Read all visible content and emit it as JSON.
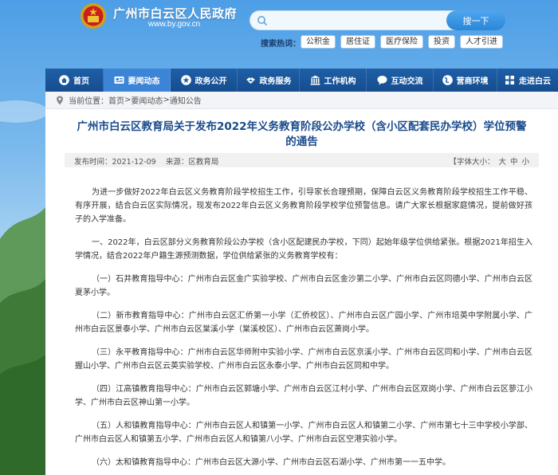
{
  "site": {
    "title": "广州市白云区人民政府",
    "url": "www.by.gov.cn"
  },
  "search": {
    "placeholder": "",
    "button": "搜一下",
    "hot_label": "搜索热词：",
    "hot_tags": [
      "公积金",
      "居住证",
      "医疗保险",
      "投资",
      "人才引进"
    ]
  },
  "nav": [
    {
      "label": "首页",
      "icon": "home-icon"
    },
    {
      "label": "要闻动态",
      "icon": "news-icon",
      "active": true
    },
    {
      "label": "政务公开",
      "icon": "star-icon"
    },
    {
      "label": "政务服务",
      "icon": "hands-icon"
    },
    {
      "label": "工作机构",
      "icon": "building-icon"
    },
    {
      "label": "互动交流",
      "icon": "chat-icon"
    },
    {
      "label": "营商环境",
      "icon": "globe-icon"
    },
    {
      "label": "走进白云",
      "icon": "grid-icon"
    }
  ],
  "breadcrumb": {
    "prefix": "当前位置：",
    "items": [
      "首页",
      "要闻动态",
      "通知公告"
    ],
    "sep": " > "
  },
  "article": {
    "title_line1": "广州市白云区教育局关于发布2022年义务教育阶段公办学校（含小区配套民办学校）学位预警",
    "title_line2": "的通告",
    "publish_label": "发布时间：",
    "publish_date": "2021-12-09",
    "source_label": "来源：",
    "source": "区教育局",
    "font_size_label": "字体大小：",
    "font_sizes": [
      "大",
      "中",
      "小"
    ],
    "paragraphs": [
      "为进一步做好2022年白云区义务教育阶段学校招生工作，引导家长合理预期，保障白云区义务教育阶段学校招生工作平稳、有序开展，结合白云区实际情况，现发布2022年白云区义务教育阶段学校学位预警信息。请广大家长根据家庭情况，提前做好孩子的入学准备。",
      "一、2022年，白云区部分义务教育阶段公办学校（含小区配建民办学校，下同）起始年级学位供给紧张。根据2021年招生入学情况，结合2022年户籍生源预测数据，学位供给紧张的义务教育学校有：",
      "（一）石井教育指导中心：广州市白云区金广实验学校、广州市白云区金沙第二小学、广州市白云区同德小学、广州市白云区夏茅小学。",
      "（二）新市教育指导中心：广州市白云区汇侨第一小学（汇侨校区）、广州市白云区广园小学、广州市培英中学附属小学、广州市白云区景泰小学、广州市白云区棠溪小学（棠溪校区）、广州市白云区萧岗小学。",
      "（三）永平教育指导中心：广州市白云区华师附中实验小学、广州市白云区京溪小学、广州市白云区同和小学、广州市白云区握山小学、广州市白云区云英实验学校、广州市白云区永泰小学、广州市白云区同和中学。",
      "（四）江高镇教育指导中心：广州市白云区郭塘小学、广州市白云区江村小学、广州市白云区双岗小学、广州市白云区蓼江小学、广州市白云区神山第一小学。",
      "（五）人和镇教育指导中心：广州市白云区人和镇第一小学、广州市白云区人和镇第二小学、广州市第七十三中学校小学部、广州市白云区人和镇第五小学、广州市白云区人和镇第八小学、广州市白云区空港实验小学。",
      "（六）太和镇教育指导中心：广州市白云区大源小学、广州市白云区石湖小学、广州市第一一五中学。"
    ]
  },
  "colors": {
    "nav_bg": "#1f5fa6",
    "nav_active": "#3b84d6",
    "title_blue": "#1a4b8c"
  }
}
